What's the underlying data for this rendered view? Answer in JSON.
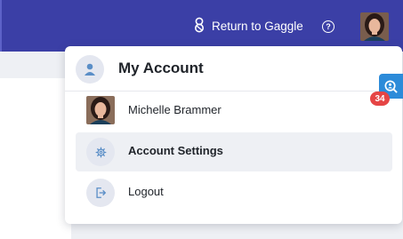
{
  "topbar": {
    "return_label": "Return to Gaggle",
    "return_icon": "gaggle-logo-icon",
    "help_icon": "help-circle-icon",
    "help_glyph": "?",
    "avatar": "user-avatar",
    "background_color": "#3b3fa6"
  },
  "dropdown": {
    "title": "My Account",
    "title_icon": "user-icon",
    "items": [
      {
        "label": "Michelle Brammer",
        "icon": "user-avatar",
        "active": false
      },
      {
        "label": "Account Settings",
        "icon": "gear-icon",
        "active": true
      },
      {
        "label": "Logout",
        "icon": "logout-icon",
        "active": false
      }
    ]
  },
  "side_widget": {
    "icon": "search-person-icon",
    "badge_count": "34",
    "badge_color": "#e54545",
    "color": "#2c8bd9"
  }
}
